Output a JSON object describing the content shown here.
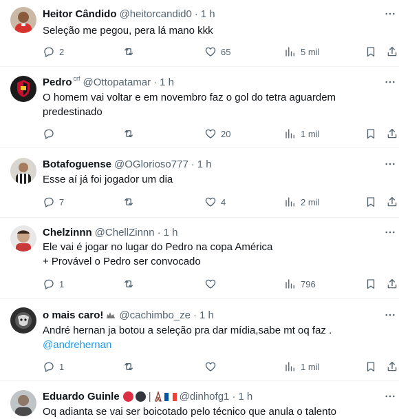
{
  "tweets": [
    {
      "name": "Heitor Cândido",
      "handle": "@heitorcandid0",
      "time": "1 h",
      "text": "Seleção me pegou, pera lá mano kkk",
      "reply_count": "2",
      "retweet_count": "",
      "like_count": "65",
      "views_count": "5 mil"
    },
    {
      "name": "Pedro",
      "badge": "crf",
      "handle": "@Ottopatamar",
      "time": "1 h",
      "text": "O homem vai voltar e em novembro faz o gol do tetra aguardem predestinado",
      "reply_count": "",
      "retweet_count": "",
      "like_count": "20",
      "views_count": "1 mil"
    },
    {
      "name": "Botafoguense",
      "handle": "@OGlorioso777",
      "time": "1 h",
      "text": "Esse aí já foi jogador um dia",
      "reply_count": "7",
      "retweet_count": "",
      "like_count": "4",
      "views_count": "2 mil"
    },
    {
      "name": "Chelzinnn",
      "handle": "@ChellZinnn",
      "time": "1 h",
      "text_line1": "Ele vai é jogar no lugar do Pedro na copa América",
      "text_line2": "+ Provável o Pedro ser convocado",
      "reply_count": "1",
      "retweet_count": "",
      "like_count": "",
      "views_count": "796"
    },
    {
      "name": "o mais caro!",
      "handle": "@cachimbo_ze",
      "time": "1 h",
      "text": "André hernan ja botou a seleção pra dar mídia,sabe mt oq faz .",
      "mention": "@andrehernan",
      "reply_count": "1",
      "retweet_count": "",
      "like_count": "",
      "views_count": "1 mil"
    },
    {
      "name": "Eduardo Guinle",
      "name_separator": "|",
      "handle": "@dinhofg1",
      "time": "1 h",
      "text": "Oq adianta se vai ser boicotado pelo técnico que anula o talento"
    }
  ],
  "separator_dot": "·",
  "colors": {
    "text": "#0f1419",
    "secondary": "#536471",
    "link": "#1d9bf0",
    "divider": "#eff3f4"
  },
  "icons": [
    "reply-icon",
    "retweet-icon",
    "like-icon",
    "views-icon",
    "bookmark-icon",
    "share-icon",
    "more-icon"
  ]
}
